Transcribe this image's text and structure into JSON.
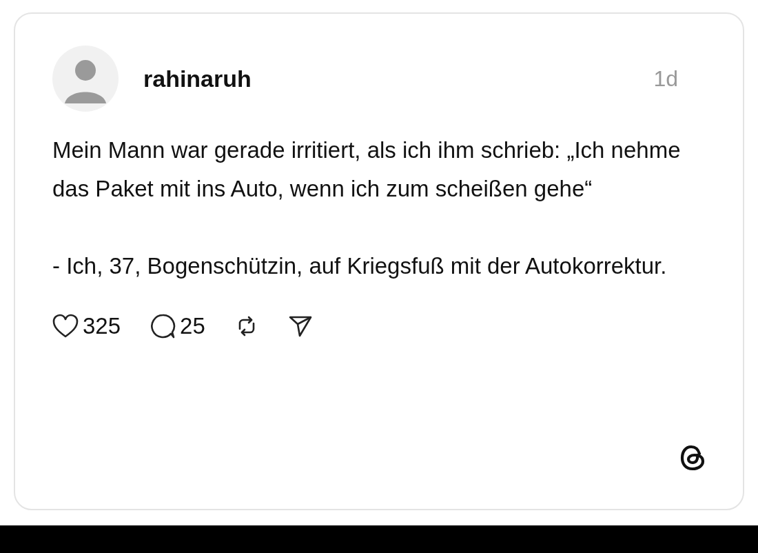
{
  "post": {
    "author": "rahinaruh",
    "time": "1d",
    "paragraphs": [
      "Mein Mann war gerade irritiert, als ich ihm schrieb: „Ich nehme das Paket mit ins Auto, wenn ich zum scheißen gehe“",
      "- Ich, 37, Bogenschützin, auf Kriegsfuß mit der Autokorrektur."
    ],
    "likes": "325",
    "comments": "25"
  }
}
